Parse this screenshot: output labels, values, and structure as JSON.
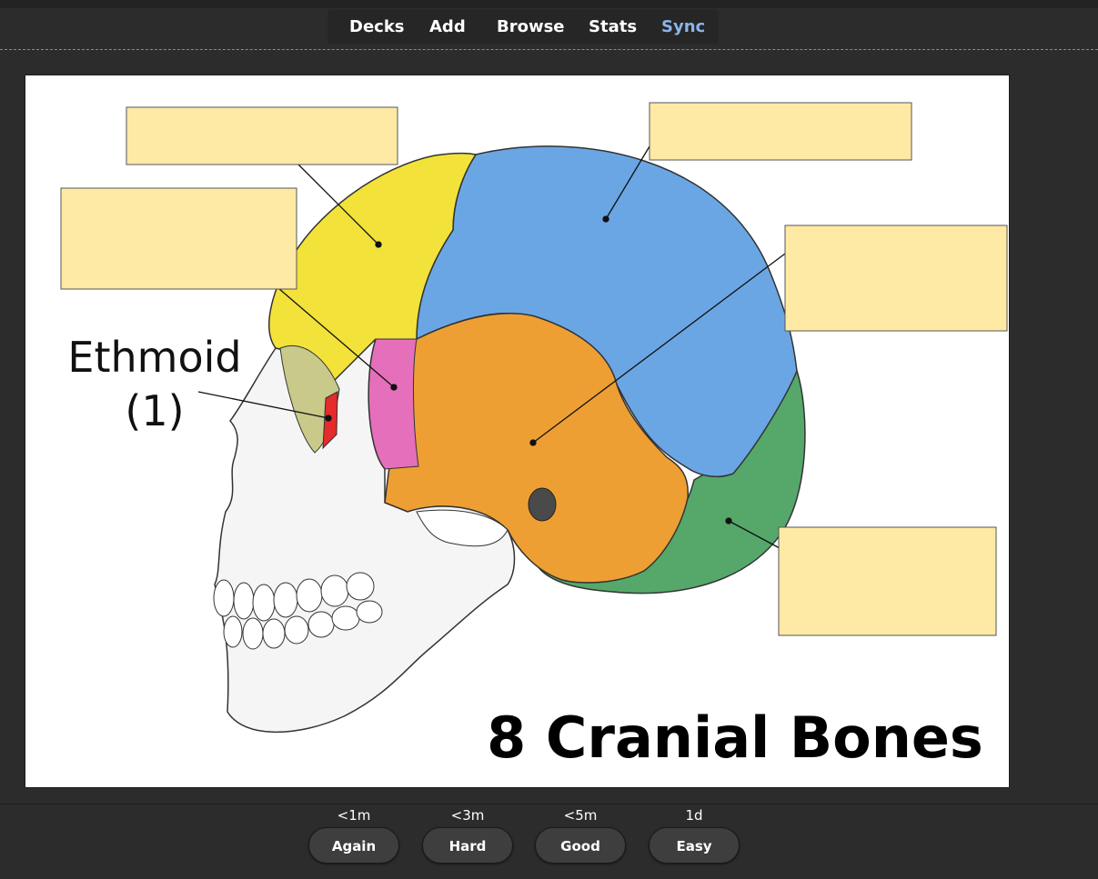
{
  "nav": {
    "decks": "Decks",
    "add": "Add",
    "browse": "Browse",
    "stats": "Stats",
    "sync": "Sync",
    "sync_color": "#8cb4ea"
  },
  "card": {
    "label_ethmoid": "Ethmoid",
    "label_ethmoid_count": "(1)",
    "title": "8 Cranial Bones",
    "occlusion_color": "#ffeaa5",
    "bone_colors": {
      "frontal": "#f2e23a",
      "parietal": "#6aa6e4",
      "temporal": "#ee9f34",
      "occipital": "#55a86a",
      "sphenoid": "#e56fba",
      "ethmoid": "#e52b2b"
    }
  },
  "answers": [
    {
      "interval": "<1m",
      "label": "Again"
    },
    {
      "interval": "<3m",
      "label": "Hard"
    },
    {
      "interval": "<5m",
      "label": "Good"
    },
    {
      "interval": "1d",
      "label": "Easy"
    }
  ]
}
